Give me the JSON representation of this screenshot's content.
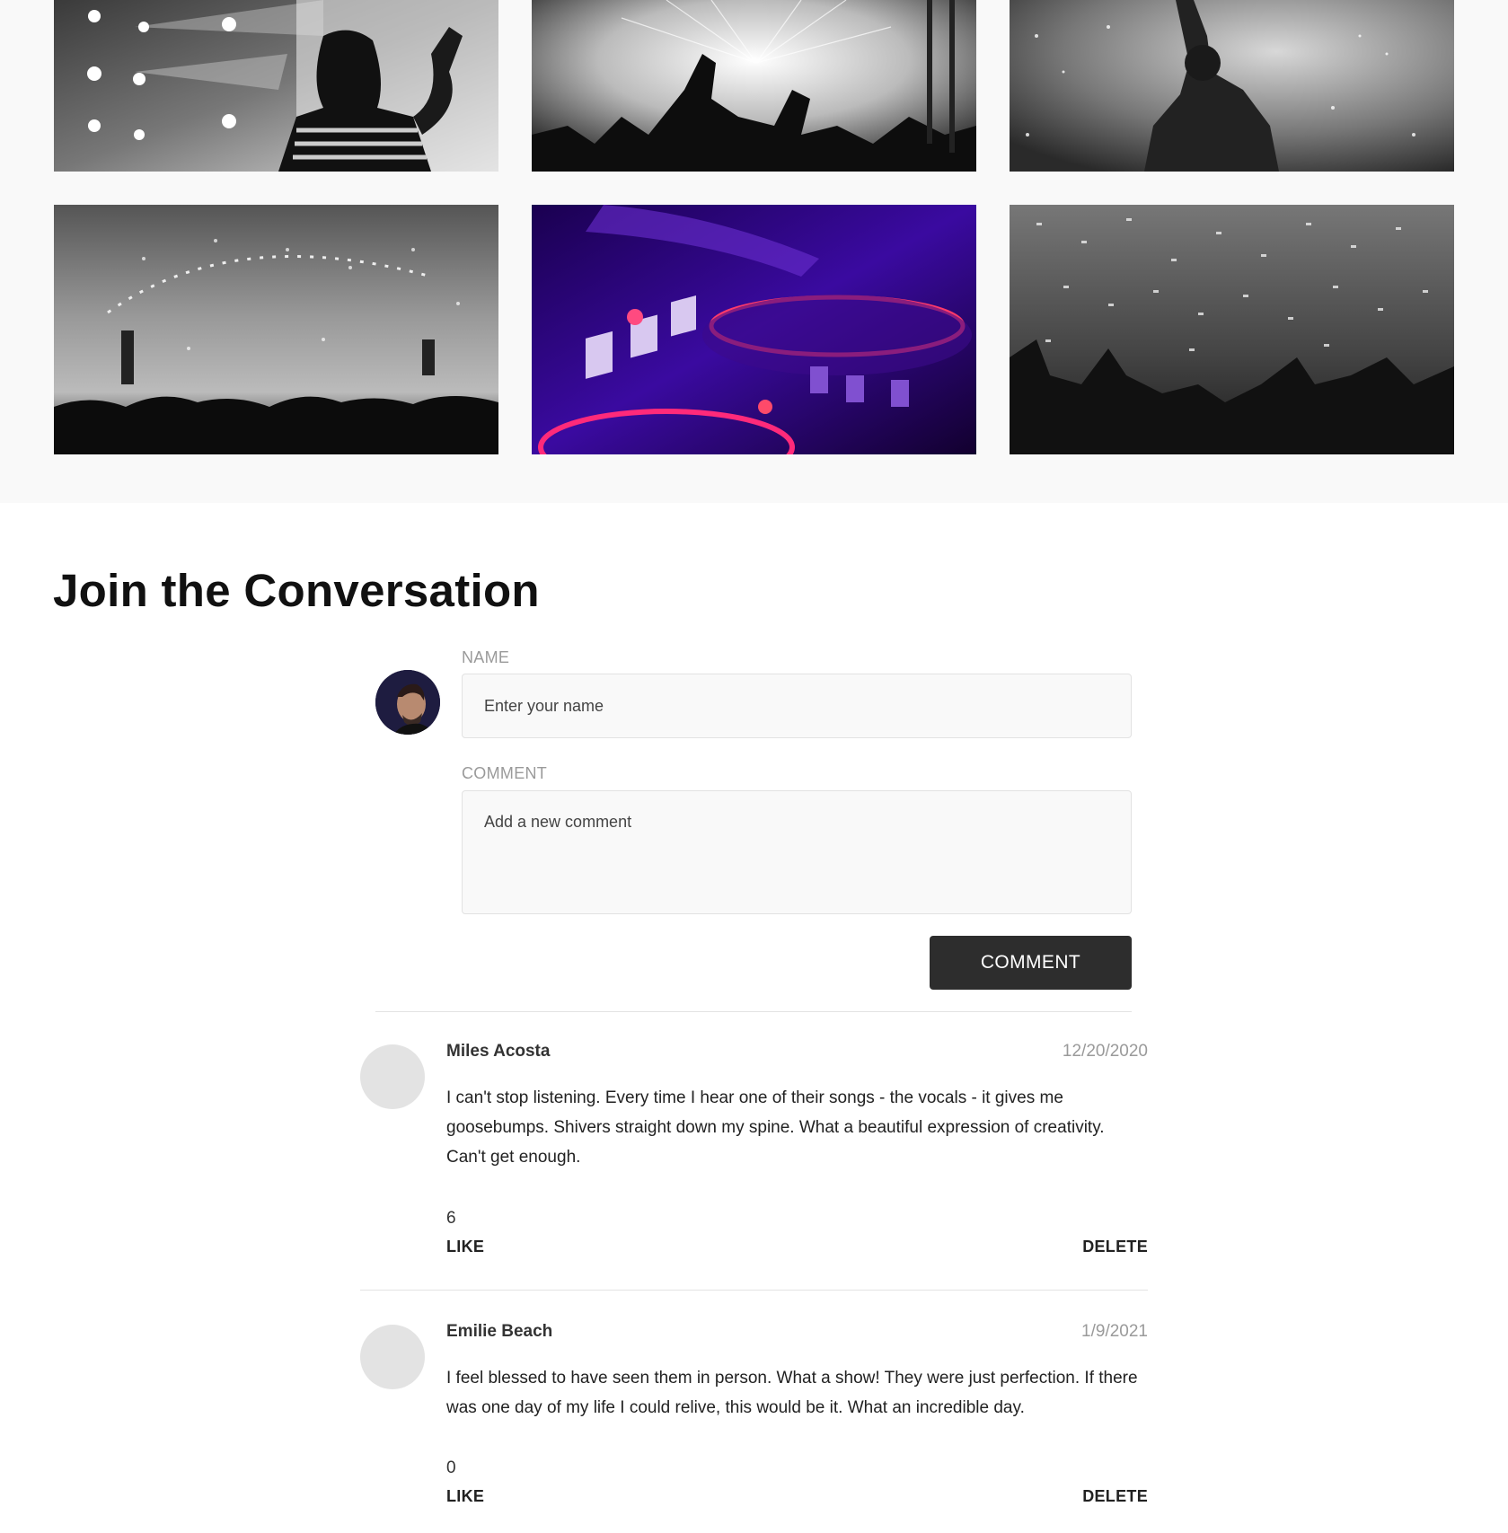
{
  "gallery": {
    "images": [
      {
        "alt": "concert-woman-waving"
      },
      {
        "alt": "concert-fireworks-crowd"
      },
      {
        "alt": "performer-smoke"
      },
      {
        "alt": "stadium-confetti-lights"
      },
      {
        "alt": "dj-turntable-purple"
      },
      {
        "alt": "crowd-confetti"
      }
    ]
  },
  "conversation": {
    "title": "Join the Conversation",
    "form": {
      "name_label": "NAME",
      "name_placeholder": "Enter your name",
      "comment_label": "COMMENT",
      "comment_placeholder": "Add a new comment",
      "submit_label": "COMMENT"
    },
    "comments": [
      {
        "author": "Miles Acosta",
        "date": "12/20/2020",
        "body": "I can't stop listening. Every time I hear one of their songs - the vocals - it gives me goosebumps. Shivers straight down my spine. What a beautiful expression of creativity. Can't get enough.",
        "likes": "6",
        "like_label": "LIKE",
        "delete_label": "DELETE"
      },
      {
        "author": "Emilie Beach",
        "date": "1/9/2021",
        "body": "I feel blessed to have seen them in person. What a show! They were just perfection. If there was one day of my life I could relive, this would be it. What an incredible day.",
        "likes": "0",
        "like_label": "LIKE",
        "delete_label": "DELETE"
      }
    ]
  },
  "colors": {
    "button_bg": "#2d2d2d",
    "gallery_bg": "#f9f9f9",
    "muted_text": "#9a9a9a",
    "avatar_placeholder": "#e3e3e3"
  }
}
